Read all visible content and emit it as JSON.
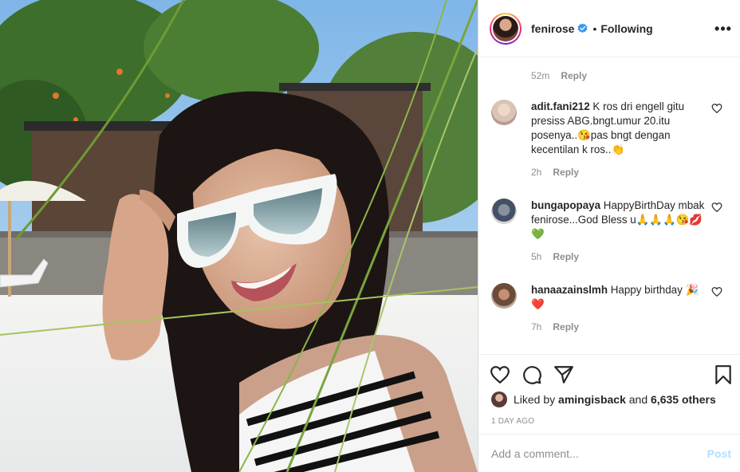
{
  "header": {
    "username": "fenirose",
    "separator": "•",
    "follow_state": "Following",
    "more_label": "•••"
  },
  "comments": {
    "top_meta": {
      "time": "52m",
      "reply": "Reply"
    },
    "items": [
      {
        "username": "adit.fani212",
        "text": "K ros dri engell gitu presiss ABG.bngt.umur 20.itu posenya..😘pas bngt dengan kecentilan k ros..👏",
        "time": "2h",
        "reply": "Reply"
      },
      {
        "username": "bungapopaya",
        "text": "HappyBirthDay mbak fenirose...God Bless u🙏🙏🙏😘💋💚",
        "time": "5h",
        "reply": "Reply"
      },
      {
        "username": "hanaazainslmh",
        "text": "Happy birthday 🎉❤️",
        "time": "7h",
        "reply": "Reply"
      }
    ]
  },
  "likes": {
    "prefix": "Liked by",
    "user": "amingisback",
    "joiner": "and",
    "count": "6,635 others"
  },
  "timestamp": "1 DAY AGO",
  "add_comment": {
    "placeholder": "Add a comment...",
    "post_label": "Post"
  },
  "icons": {
    "verified": "verified-badge-icon",
    "more": "more-options-icon",
    "like": "heart-icon",
    "comment": "comment-icon",
    "share": "paper-plane-icon",
    "save": "bookmark-icon"
  },
  "colors": {
    "verified_blue": "#3897f0",
    "muted": "#8e8e8e",
    "post_disabled": "#b2dffc"
  }
}
